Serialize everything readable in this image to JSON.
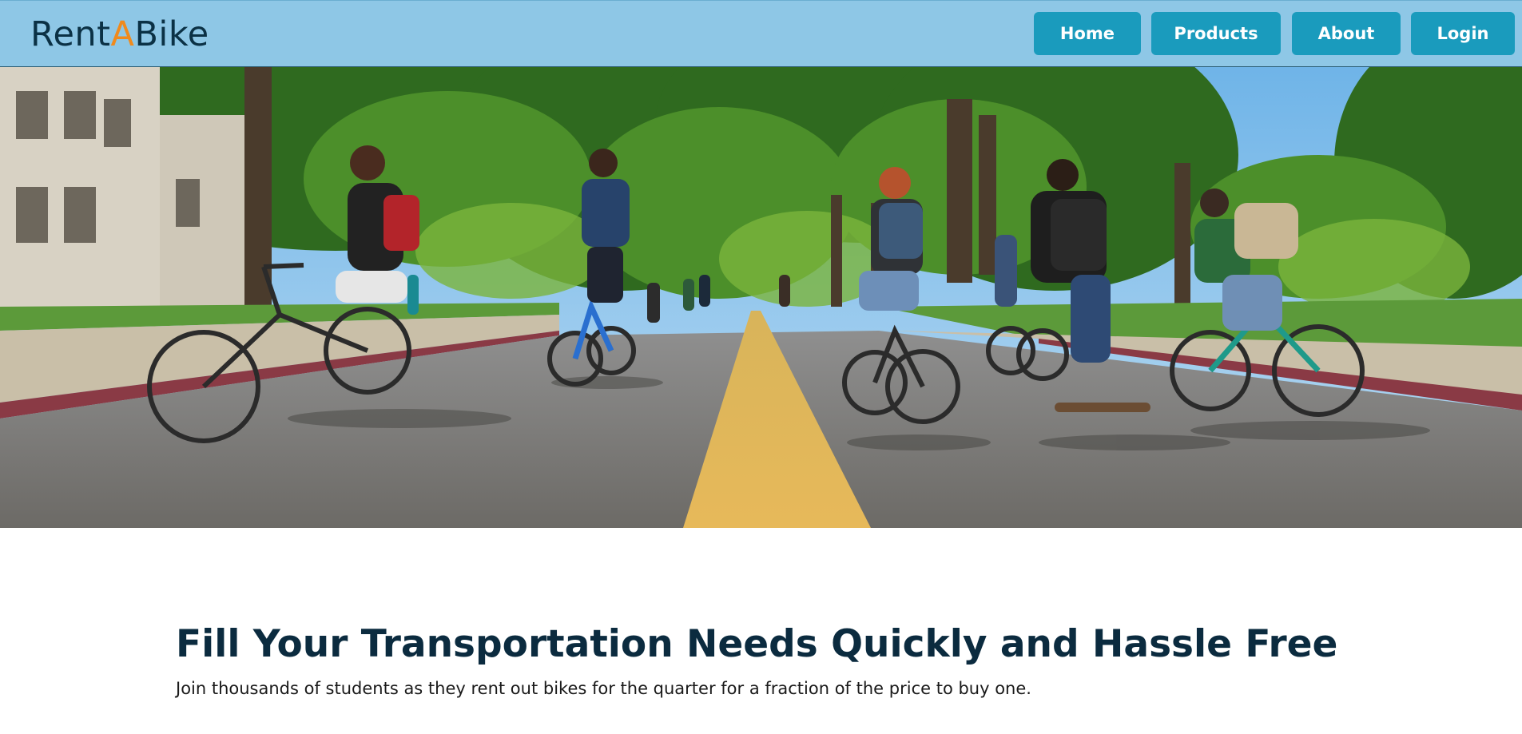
{
  "brand": {
    "logo_prefix": "Rent",
    "logo_accent": "A",
    "logo_suffix": "Bike",
    "accent_color": "#f08a1c",
    "text_color": "#0b3145"
  },
  "nav": {
    "background": "#8ec7e6",
    "button_color": "#1a9bbd",
    "items": [
      {
        "label": "Home"
      },
      {
        "label": "Products"
      },
      {
        "label": "About"
      },
      {
        "label": "Login"
      }
    ]
  },
  "hero": {
    "image_subject": "students-cycling-on-tree-lined-campus-road-photo"
  },
  "content": {
    "headline": "Fill Your Transportation Needs Quickly and Hassle Free",
    "subline": "Join thousands of students as they rent out bikes for the quarter for a fraction of the price to buy one."
  }
}
